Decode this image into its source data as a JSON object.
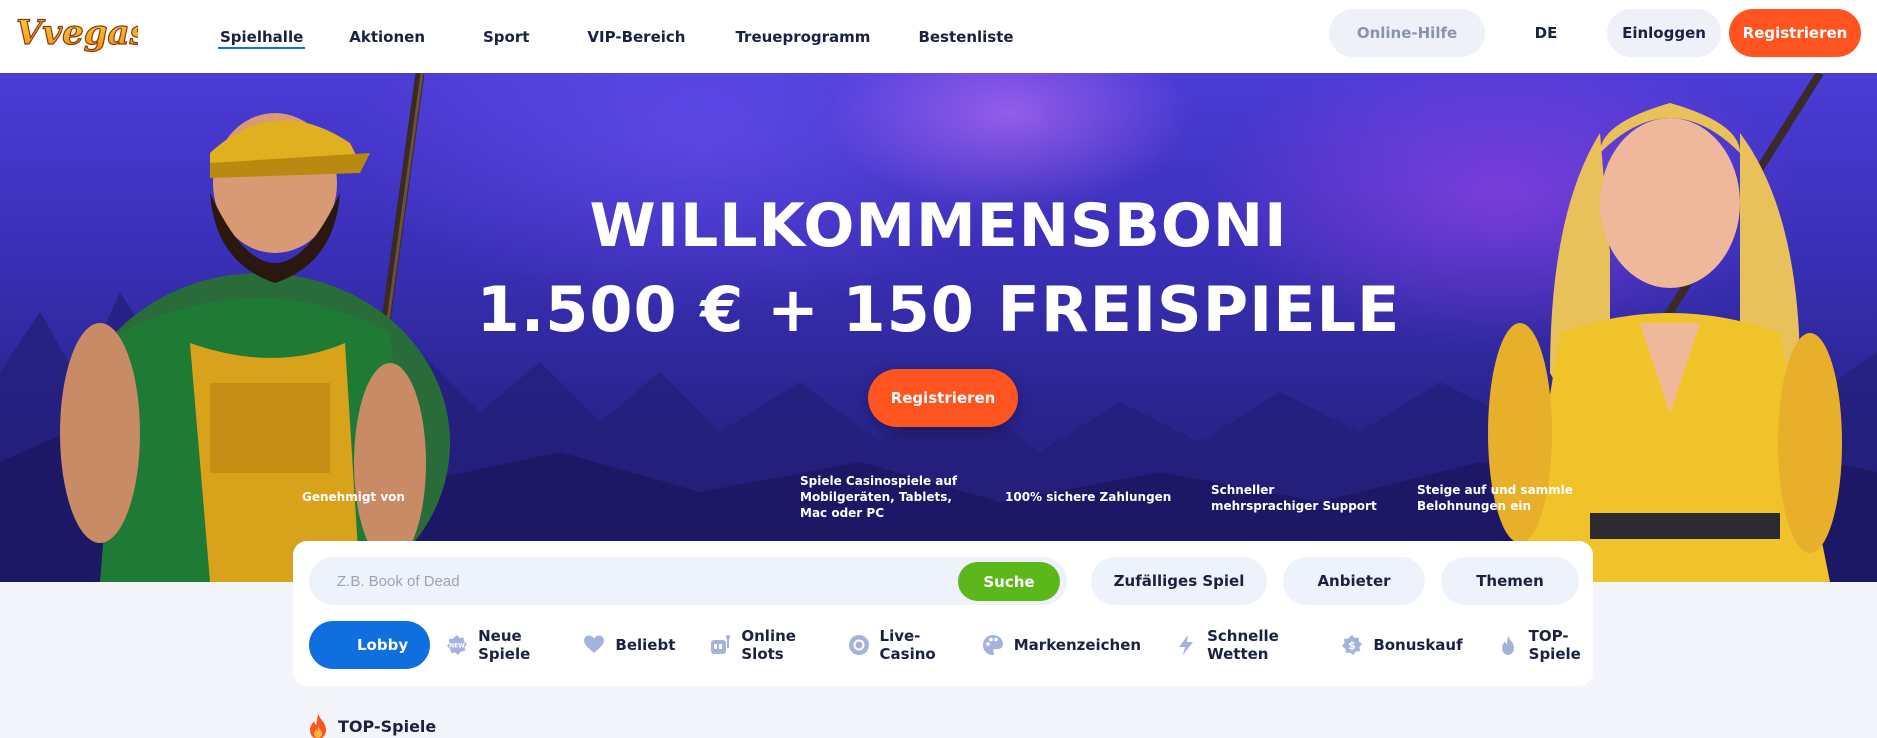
{
  "header": {
    "logo_text": "Vvegas",
    "nav": [
      {
        "label": "Spielhalle",
        "active": true
      },
      {
        "label": "Aktionen"
      },
      {
        "label": "Sport"
      },
      {
        "label": "VIP-Bereich"
      },
      {
        "label": "Treueprogramm"
      },
      {
        "label": "Bestenliste"
      }
    ],
    "help_label": "Online-Hilfe",
    "language": "DE",
    "login_label": "Einloggen",
    "register_label": "Registrieren"
  },
  "hero": {
    "title_line1": "WILLKOMMENSBONI",
    "title_line2": "1.500 € + 150 FREISPIELE",
    "cta_label": "Registrieren",
    "approved_label": "Genehmigt von",
    "features": [
      "Spiele Casinospiele auf Mobilgeräten, Tablets, Mac oder PC",
      "100% sichere Zahlungen",
      "Schneller mehrsprachiger Support",
      "Steige auf und sammle Belohnungen ein"
    ]
  },
  "search": {
    "placeholder": "Z.B. Book of Dead",
    "button_label": "Suche",
    "random_label": "Zufälliges Spiel",
    "providers_label": "Anbieter",
    "themes_label": "Themen"
  },
  "categories": [
    {
      "label": "Lobby",
      "icon": "lobby-icon",
      "active": true
    },
    {
      "label": "Neue Spiele",
      "icon": "new-badge-icon"
    },
    {
      "label": "Beliebt",
      "icon": "heart-icon"
    },
    {
      "label": "Online Slots",
      "icon": "slot-machine-icon"
    },
    {
      "label": "Live-Casino",
      "icon": "live-chip-icon"
    },
    {
      "label": "Markenzeichen",
      "icon": "palette-icon"
    },
    {
      "label": "Schnelle Wetten",
      "icon": "lightning-icon"
    },
    {
      "label": "Bonuskauf",
      "icon": "dollar-badge-icon"
    },
    {
      "label": "TOP-Spiele",
      "icon": "flame-icon"
    }
  ],
  "section": {
    "title": "TOP-Spiele",
    "icon": "flame-icon"
  },
  "colors": {
    "brand_orange": "#ff5420",
    "accent_blue": "#0f6fde",
    "search_green": "#5cb81a"
  }
}
